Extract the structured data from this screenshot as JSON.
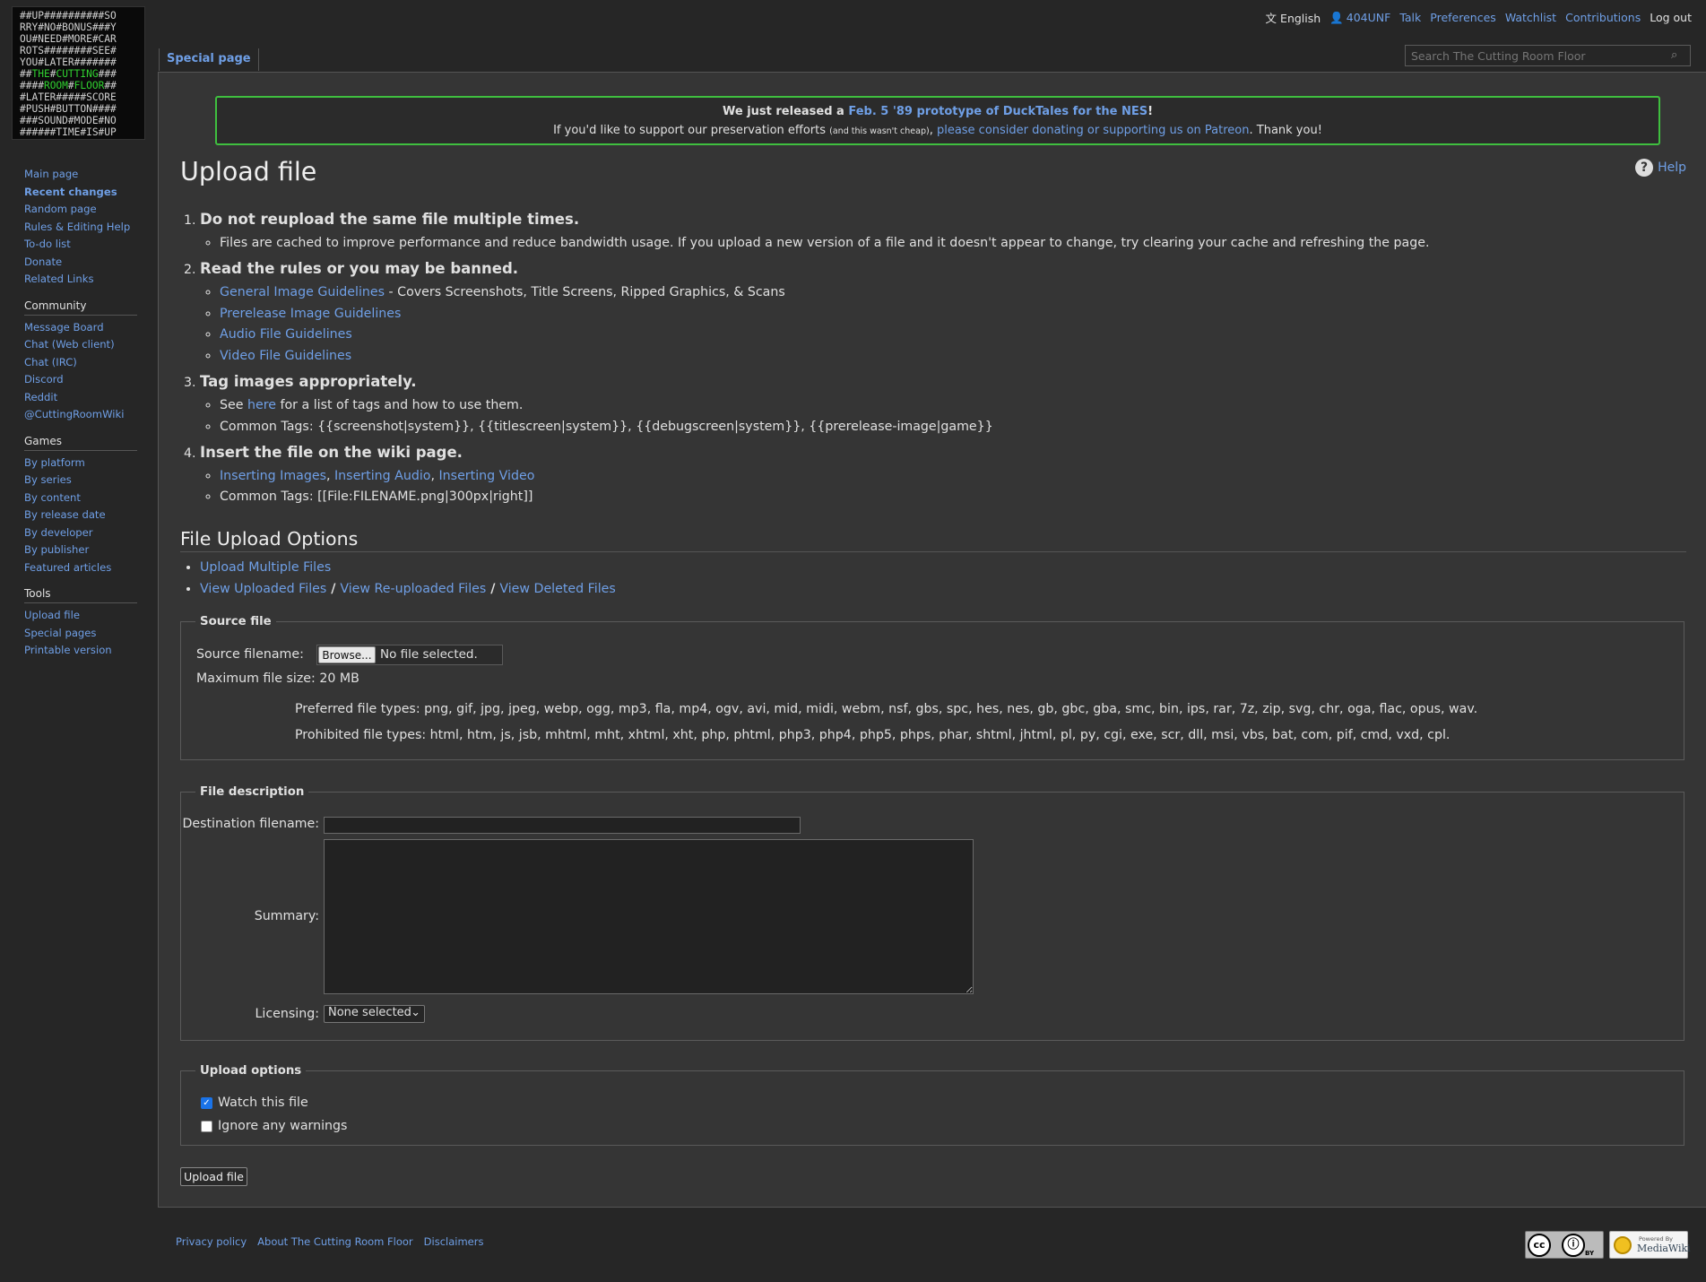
{
  "logo": {
    "lines": [
      [
        {
          "t": "##UP##########SO",
          "g": false
        }
      ],
      [
        {
          "t": "RRY#NO#BONUS###Y",
          "g": false
        }
      ],
      [
        {
          "t": "OU#NEED#MORE#CAR",
          "g": false
        }
      ],
      [
        {
          "t": "ROTS########SEE#",
          "g": false
        }
      ],
      [
        {
          "t": "YOU#LATER#######",
          "g": false
        }
      ],
      [
        {
          "t": "##",
          "g": false
        },
        {
          "t": "THE",
          "g": true
        },
        {
          "t": "#",
          "g": false
        },
        {
          "t": "CUTTING",
          "g": true
        },
        {
          "t": "###",
          "g": false
        }
      ],
      [
        {
          "t": "####",
          "g": false
        },
        {
          "t": "ROOM",
          "g": true
        },
        {
          "t": "#",
          "g": false
        },
        {
          "t": "FLOOR",
          "g": true
        },
        {
          "t": "##",
          "g": false
        }
      ],
      [
        {
          "t": "#LATER#####SCORE",
          "g": false
        }
      ],
      [
        {
          "t": "#PUSH#BUTTON####",
          "g": false
        }
      ],
      [
        {
          "t": "###SOUND#MODE#NO",
          "g": false
        }
      ],
      [
        {
          "t": "######TIME#IS#UP",
          "g": false
        }
      ]
    ]
  },
  "personal": {
    "language": "English",
    "username": "404UNF",
    "talk": "Talk",
    "preferences": "Preferences",
    "watchlist": "Watchlist",
    "contributions": "Contributions",
    "logout": "Log out"
  },
  "tabs": {
    "special": "Special page"
  },
  "search": {
    "placeholder": "Search The Cutting Room Floor"
  },
  "sidebar": {
    "navigation": [
      "Main page",
      "Recent changes",
      "Random page",
      "Rules & Editing Help",
      "To-do list",
      "Donate",
      "Related Links"
    ],
    "community": {
      "title": "Community",
      "items": [
        "Message Board",
        "Chat (Web client)",
        "Chat (IRC)",
        "Discord",
        "Reddit",
        "@CuttingRoomWiki"
      ]
    },
    "games": {
      "title": "Games",
      "items": [
        "By platform",
        "By series",
        "By content",
        "By release date",
        "By developer",
        "By publisher",
        "Featured articles"
      ]
    },
    "tools": {
      "title": "Tools",
      "items": [
        "Upload file",
        "Special pages",
        "Printable version"
      ]
    }
  },
  "sitenotice": {
    "line1_pre": "We just released a ",
    "line1_link": "Feb. 5 '89 prototype of DuckTales for the NES",
    "line1_post": "!",
    "line2_pre": "If you'd like to support our preservation efforts ",
    "line2_small": "(and this wasn't cheap)",
    "line2_comma": ", ",
    "line2_link": "please consider donating or supporting us on Patreon",
    "line2_post": ". Thank you!"
  },
  "page": {
    "title": "Upload file",
    "help": "Help"
  },
  "rules": {
    "r1": {
      "heading": "Do not reupload the same file multiple times.",
      "item": "Files are cached to improve performance and reduce bandwidth usage. If you upload a new version of a file and it doesn't appear to change, try clearing your cache and refreshing the page."
    },
    "r2": {
      "heading": "Read the rules or you may be banned.",
      "general_link": "General Image Guidelines",
      "general_desc": " - Covers Screenshots, Title Screens, Ripped Graphics, & Scans",
      "prerelease": "Prerelease Image Guidelines",
      "audio": "Audio File Guidelines",
      "video": "Video File Guidelines"
    },
    "r3": {
      "heading": "Tag images appropriately.",
      "see_pre": "See ",
      "see_link": "here",
      "see_post": " for a list of tags and how to use them.",
      "tags": "Common Tags: {{screenshot|system}}, {{titlescreen|system}}, {{debugscreen|system}}, {{prerelease-image|game}}"
    },
    "r4": {
      "heading": "Insert the file on the wiki page.",
      "images": "Inserting Images",
      "audio": "Inserting Audio",
      "video": "Inserting Video",
      "comma": ", ",
      "tags": "Common Tags: [[File:FILENAME.png|300px|right]]"
    }
  },
  "upload_options_section": {
    "heading": "File Upload Options",
    "multiple": "Upload Multiple Files",
    "uploaded": "View Uploaded Files",
    "reuploaded": "View Re-uploaded Files",
    "deleted": "View Deleted Files",
    "sep": " / "
  },
  "source_file": {
    "legend": "Source file",
    "label": "Source filename:",
    "browse": "Browse...",
    "nofile": "No file selected.",
    "maxsize": "Maximum file size: 20 MB",
    "preferred": "Preferred file types: png, gif, jpg, jpeg, webp, ogg, mp3, fla, mp4, ogv, avi, mid, midi, webm, nsf, gbs, spc, hes, nes, gb, gbc, gba, smc, bin, ips, rar, 7z, zip, svg, chr, oga, flac, opus, wav.",
    "prohibited": "Prohibited file types: html, htm, js, jsb, mhtml, mht, xhtml, xht, php, phtml, php3, php4, php5, phps, phar, shtml, jhtml, pl, py, cgi, exe, scr, dll, msi, vbs, bat, com, pif, cmd, vxd, cpl."
  },
  "file_description": {
    "legend": "File description",
    "dest_label": "Destination filename:",
    "summary_label": "Summary:",
    "licensing_label": "Licensing:",
    "licensing_value": "None selected"
  },
  "upload_options": {
    "legend": "Upload options",
    "watch": "Watch this file",
    "watch_checked": true,
    "ignore": "Ignore any warnings",
    "ignore_checked": false
  },
  "submit": {
    "label": "Upload file"
  },
  "footer": {
    "privacy": "Privacy policy",
    "about": "About The Cutting Room Floor",
    "disclaimers": "Disclaimers",
    "cc_by": "BY",
    "powered_by": "Powered By",
    "mediawiki": "MediaWiki"
  }
}
